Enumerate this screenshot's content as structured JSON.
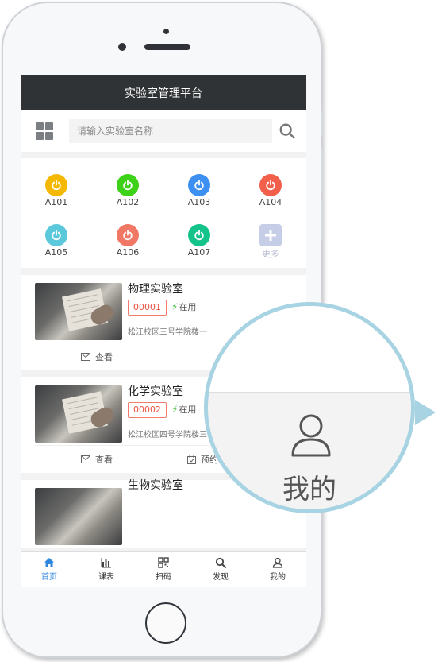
{
  "app": {
    "title": "实验室管理平台"
  },
  "search": {
    "placeholder": "请输入实验室名称"
  },
  "rooms": [
    {
      "label": "A101",
      "color": "#f5b800"
    },
    {
      "label": "A102",
      "color": "#3dd118"
    },
    {
      "label": "A103",
      "color": "#3d8ff2"
    },
    {
      "label": "A104",
      "color": "#f2604b"
    },
    {
      "label": "A105",
      "color": "#5cc8dc"
    },
    {
      "label": "A106",
      "color": "#f27866"
    },
    {
      "label": "A107",
      "color": "#13c38a"
    }
  ],
  "more_label": "更多",
  "cards": [
    {
      "title": "物理实验室",
      "code": "00001",
      "status": "在用",
      "address": "松江校区三号学院楼一",
      "view_label": "查看",
      "book_label": ""
    },
    {
      "title": "化学实验室",
      "code": "00002",
      "status": "在用",
      "address": "松江校区四号学院楼三",
      "view_label": "查看",
      "book_label": "预约"
    },
    {
      "title": "生物实验室"
    }
  ],
  "tabs": [
    {
      "label": "首页",
      "icon": "home-icon",
      "active": true
    },
    {
      "label": "课表",
      "icon": "bar-chart-icon"
    },
    {
      "label": "扫码",
      "icon": "qrcode-icon"
    },
    {
      "label": "发现",
      "icon": "search-icon"
    },
    {
      "label": "我的",
      "icon": "user-icon"
    }
  ],
  "magnifier": {
    "label": "我的",
    "icon": "user-icon"
  },
  "colors": {
    "titlebar": "#2f3335",
    "accent": "#2e86de",
    "magnifier_ring": "#a8d3e3"
  }
}
